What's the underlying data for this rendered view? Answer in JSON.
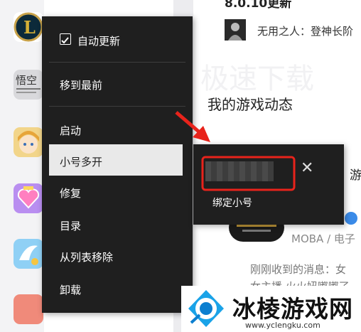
{
  "main": {
    "top_title": "8.0.10更新",
    "post_text": "无用之人：登神长阶",
    "watermark": "极速下载",
    "section_title": "我的游戏动态",
    "cut_label": "游",
    "game_genre": "MOBA / 电子",
    "message_line1": "刚刚收到的消息：女",
    "message_line2": "女主播 火火妞嘟嘟了"
  },
  "context_menu": {
    "auto_update_label": "自动更新",
    "auto_update_checked": true,
    "items": [
      "移到最前",
      "启动",
      "小号多开",
      "修复",
      "目录",
      "从列表移除",
      "卸载"
    ],
    "highlighted_item": "小号多开"
  },
  "submenu": {
    "bind_label": "绑定小号",
    "close_symbol": "✕"
  },
  "banner": {
    "name": "冰棱游戏网",
    "url": "www.yclengku.com"
  },
  "colors": {
    "menu_bg": "#1f1f1f",
    "highlight_bg": "#e9e9e9",
    "annotation_red": "#e8231b",
    "banner_blue": "#1aa3e8"
  }
}
